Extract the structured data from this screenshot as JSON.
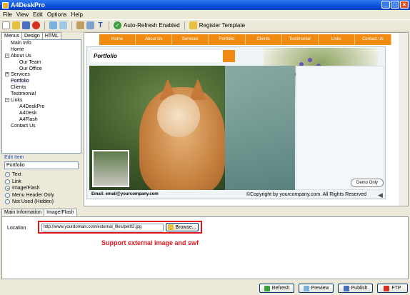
{
  "window": {
    "title": "A4DeskPro"
  },
  "menu": [
    "File",
    "View",
    "Edit",
    "Options",
    "Help"
  ],
  "toolbar": {
    "auto_refresh": "Auto-Refresh Enabled",
    "register": "Register Template"
  },
  "left_tabs": [
    "Menus",
    "Design",
    "HTML"
  ],
  "tree": [
    {
      "label": "Main Info",
      "indent": 0,
      "exp": ""
    },
    {
      "label": "Home",
      "indent": 0,
      "exp": ""
    },
    {
      "label": "About Us",
      "indent": 0,
      "exp": "−"
    },
    {
      "label": "Our Team",
      "indent": 2,
      "exp": ""
    },
    {
      "label": "Our Office",
      "indent": 2,
      "exp": ""
    },
    {
      "label": "Services",
      "indent": 0,
      "exp": "+"
    },
    {
      "label": "Portfolio",
      "indent": 0,
      "exp": "",
      "selected": true
    },
    {
      "label": "Clients",
      "indent": 0,
      "exp": ""
    },
    {
      "label": "Testimonial",
      "indent": 0,
      "exp": ""
    },
    {
      "label": "Links",
      "indent": 0,
      "exp": "−"
    },
    {
      "label": "A4DeskPro",
      "indent": 2,
      "exp": ""
    },
    {
      "label": "A4Desk",
      "indent": 2,
      "exp": ""
    },
    {
      "label": "A4Flash",
      "indent": 2,
      "exp": ""
    },
    {
      "label": "Contact Us",
      "indent": 0,
      "exp": ""
    }
  ],
  "edit_item": {
    "label": "Edit Item",
    "value": "Portfolio",
    "options": [
      {
        "label": "Text",
        "on": false
      },
      {
        "label": "Link",
        "on": false
      },
      {
        "label": "Image/Flash",
        "on": true
      },
      {
        "label": "Menu Header Only",
        "on": false
      },
      {
        "label": "Not Used (Hidden)",
        "on": false
      }
    ]
  },
  "site": {
    "nav": [
      "Home",
      "About Us",
      "Services",
      "Portfolio",
      "Clients",
      "Testimonial",
      "Links",
      "Contact Us"
    ],
    "page_title": "Portfolio",
    "demo_button": "Demo Only",
    "email": "Email: email@yourcompany.com",
    "copyright": "©Copyright by yourcompany.com. All Rights Reserved"
  },
  "bottom_tabs": [
    "Main Information",
    "Image/Flash"
  ],
  "location": {
    "label": "Location",
    "value": "http://www.yourdomain.com/external_files/pet02.jpg",
    "browse": "Browse..."
  },
  "annotation": "Support external image and swf",
  "buttons": {
    "refresh": "Refresh",
    "preview": "Preview",
    "publish": "Publish",
    "ftp": "FTP"
  },
  "colors": {
    "accent": "#f08a10",
    "title_bar": "#0a4fd8",
    "annotation": "#e0161c"
  }
}
